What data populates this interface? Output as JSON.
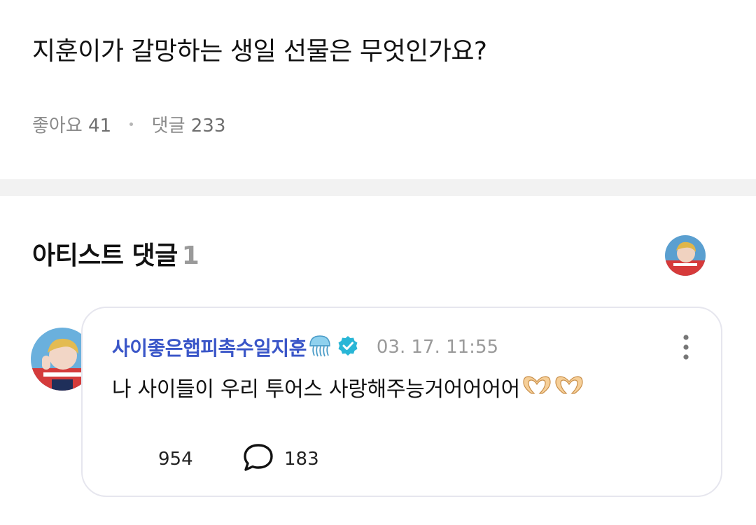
{
  "post": {
    "title": "지훈이가 갈망하는 생일 선물은 무엇인가요?",
    "likes_label": "좋아요",
    "likes_count": "41",
    "comments_label": "댓글",
    "comments_count": "233"
  },
  "artist_section": {
    "title": "아티스트 댓글",
    "count": "1"
  },
  "comment": {
    "author": "사이좋은햅피촉수일지훈",
    "timestamp": "03. 17. 11:55",
    "text": "나 사이들이 우리 투어스 사랑해주능거어어어어",
    "like_count": "954",
    "reply_count": "183"
  },
  "colors": {
    "author": "#3a56c8",
    "verified": "#29b6d6",
    "muted": "#9a9a9a",
    "card_border": "#e6e6ee"
  },
  "icons": [
    "jellyfish-icon",
    "verified-badge-icon",
    "more-vertical-icon",
    "heart-hands-icon",
    "speech-bubble-icon"
  ]
}
